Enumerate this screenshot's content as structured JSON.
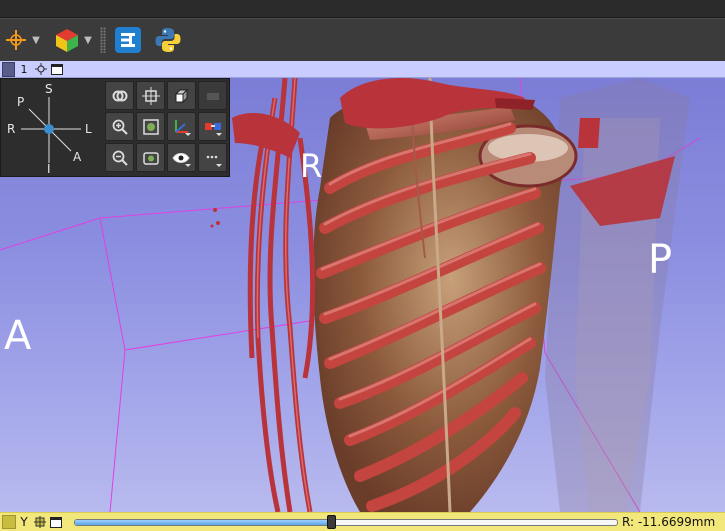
{
  "toolbar": {
    "icons": [
      "crosshair-icon",
      "chevron-down-icon",
      "layout-cube-icon",
      "chevron-down-icon",
      "toolbar-grip-icon",
      "extension-manager-icon",
      "python-console-icon"
    ]
  },
  "view_header": {
    "view_number": "1",
    "icons": [
      "pin-icon",
      "view-options-icon",
      "maximize-view-icon"
    ]
  },
  "orientation_labels": {
    "right": "R",
    "posterior": "P",
    "anterior": "A"
  },
  "compass": {
    "superior": "S",
    "posterior": "P",
    "right": "R",
    "left": "L",
    "anterior": "A",
    "inferior": "I"
  },
  "controls": {
    "buttons": [
      "link-views-icon",
      "center-view-icon",
      "orthographic-toggle-icon",
      "disabled-action-icon",
      "zoom-in-icon",
      "fit-view-icon",
      "axes-visibility-icon",
      "stereo-view-icon",
      "zoom-out-icon",
      "screenshot-icon",
      "eye-visibility-icon",
      "more-options-icon"
    ]
  },
  "slice_bar": {
    "axis": "Y",
    "readout": "R: -11.6699mm",
    "slider_fraction": 0.475
  },
  "colors": {
    "slice_bar": "#f2e77a",
    "view_header": "#c9ccff",
    "viewport_top": "#7b7dd6",
    "viewport_bottom": "#b8baee",
    "bounding_box": "#e040e0",
    "vessel": "#b8333a"
  }
}
